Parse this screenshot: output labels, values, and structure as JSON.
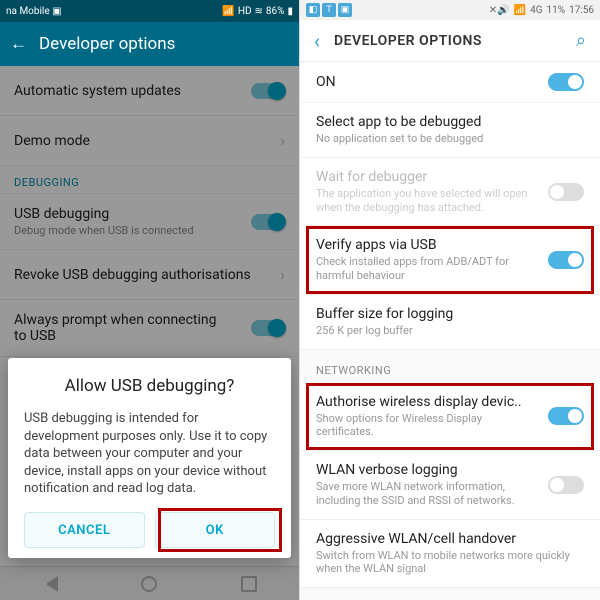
{
  "left": {
    "status": {
      "carrier": "na Mobile",
      "icon": "▣",
      "signal": "📶",
      "hd": "HD",
      "wifi": "≋",
      "battery_pct": "86%",
      "battery_icon": "▮"
    },
    "header": {
      "back": "←",
      "title": "Developer options"
    },
    "rows": {
      "auto_update": {
        "title": "Automatic system updates"
      },
      "demo": {
        "title": "Demo mode",
        "chev": "›"
      },
      "section_debug": "DEBUGGING",
      "usb_debug": {
        "title": "USB debugging",
        "sub": "Debug mode when USB is connected"
      },
      "revoke": {
        "title": "Revoke USB debugging authorisations",
        "chev": "›"
      },
      "always": {
        "title": "Always prompt when connecting to USB"
      }
    },
    "dialog": {
      "title": "Allow USB debugging?",
      "body": "USB debugging is intended for development purposes only. Use it to copy data between your computer and your device, install apps on your device without notification and read log data.",
      "cancel": "CANCEL",
      "ok": "OK"
    }
  },
  "right": {
    "status": {
      "icons": [
        "◧",
        "T",
        "▣"
      ],
      "mute": "✕🔊",
      "sig": "📶",
      "net": "4G",
      "bat": "11%",
      "time": "17:56"
    },
    "header": {
      "back": "‹",
      "title": "DEVELOPER OPTIONS",
      "search": "⌕"
    },
    "rows": {
      "on": {
        "title": "ON"
      },
      "select": {
        "title": "Select app to be debugged",
        "sub": "No application set to be debugged"
      },
      "wait": {
        "title": "Wait for debugger",
        "sub": "The application you have selected will open when the debugging has attached."
      },
      "verify": {
        "title": "Verify apps via USB",
        "sub": "Check installed apps from ADB/ADT for harmful behaviour"
      },
      "buffer": {
        "title": "Buffer size for logging",
        "sub": "256 K per log buffer"
      },
      "section_net": "NETWORKING",
      "auth": {
        "title": "Authorise wireless display devic..",
        "sub": "Show options for Wireless Display certificates."
      },
      "wlan": {
        "title": "WLAN verbose logging",
        "sub": "Save more WLAN network information, including the SSID and RSSI of networks."
      },
      "agg": {
        "title": "Aggressive WLAN/cell handover",
        "sub": "Switch from WLAN to mobile networks more quickly when the WLAN signal"
      }
    }
  }
}
